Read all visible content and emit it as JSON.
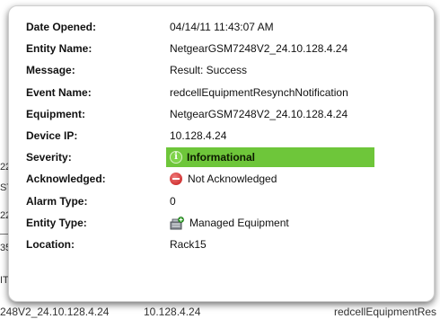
{
  "background": {
    "left_fragments": [
      "22",
      "ST",
      "22",
      "35",
      "IT"
    ],
    "bottom_row": {
      "col1": "248V2_24.10.128.4.24",
      "col2": "10.128.4.24",
      "col3": "redcellEquipmentRes"
    }
  },
  "tooltip": {
    "rows": [
      {
        "label": "Date Opened:",
        "value": "04/14/11 11:43:07 AM"
      },
      {
        "label": "Entity Name:",
        "value": "NetgearGSM7248V2_24.10.128.4.24"
      },
      {
        "label": "Message:",
        "value": "Result: Success"
      },
      {
        "label": "Event Name:",
        "value": "redcellEquipmentResynchNotification"
      },
      {
        "label": "Equipment:",
        "value": "NetgearGSM7248V2_24.10.128.4.24"
      },
      {
        "label": "Device IP:",
        "value": "10.128.4.24"
      },
      {
        "label": "Severity:",
        "value": "Informational",
        "icon": "info-icon",
        "highlight_color": "#6ec63a"
      },
      {
        "label": "Acknowledged:",
        "value": "Not Acknowledged",
        "icon": "no-entry-icon"
      },
      {
        "label": "Alarm Type:",
        "value": "0"
      },
      {
        "label": "Entity Type:",
        "value": "Managed Equipment",
        "icon": "managed-equipment-icon"
      },
      {
        "label": "Location:",
        "value": "Rack15"
      }
    ]
  }
}
